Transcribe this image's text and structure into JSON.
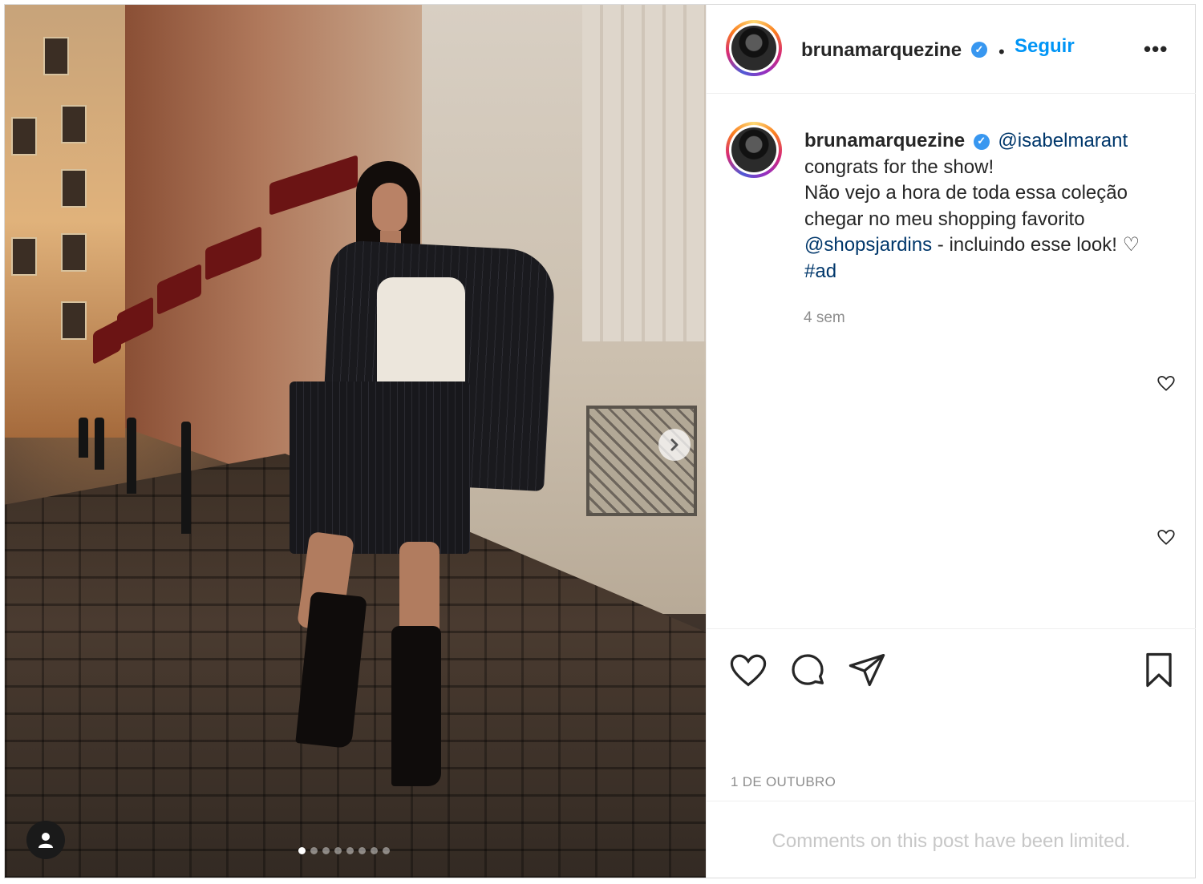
{
  "post": {
    "username": "brunamarquezine",
    "follow_label": "Seguir",
    "separator": "•",
    "more_label": "•••",
    "verified_mark": "✓"
  },
  "caption": {
    "username": "brunamarquezine",
    "mention_1": "@isabelmarant",
    "line_1": "congrats for the show!",
    "line_2": "Não vejo a hora de toda essa coleção",
    "line_3": "chegar no meu shopping favorito",
    "mention_2": "@shopsjardins",
    "line_4_rest": " - incluindo esse look! ♡",
    "hashtag": "#ad",
    "time_ago": "4 sem"
  },
  "meta": {
    "date": "1 DE OUTUBRO",
    "comments_limited": "Comments on this post have been limited."
  },
  "carousel": {
    "slide_count": 8,
    "active_index": 0
  },
  "icons": {
    "like": "heart-icon",
    "comment": "comment-icon",
    "share": "paper-plane-icon",
    "save": "bookmark-icon",
    "next": "chevron-right-icon",
    "tag": "user-icon"
  },
  "colors": {
    "link_blue": "#0095f6",
    "mention_blue": "#00376b",
    "verified_blue": "#3897f0",
    "muted_gray": "#8e8e8e"
  }
}
